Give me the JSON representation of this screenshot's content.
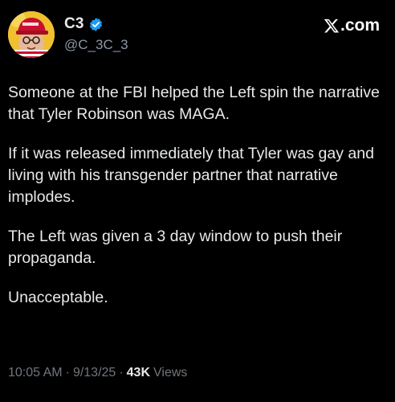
{
  "author": {
    "display_name": "C3",
    "handle": "@C_3C_3",
    "verified": true,
    "verified_color": "#1d9bf0",
    "avatar_icon": "avatar-red-cap-icon"
  },
  "brand": {
    "logo_icon": "x-logo-icon",
    "suffix": ".com"
  },
  "body": {
    "paragraphs": [
      "Someone at the FBI helped the Left spin the narrative that Tyler Robinson was MAGA.",
      "If it was released immediately that Tyler was gay and living with his transgender partner that narrative implodes.",
      "The Left was given a 3 day window to push their propaganda.",
      "Unacceptable."
    ]
  },
  "meta": {
    "time": "10:05 AM",
    "separator": "·",
    "date": "9/13/25",
    "views_count": "43K",
    "views_label": "Views"
  },
  "colors": {
    "background": "#000000",
    "text": "#e7e9ea",
    "secondary": "#71767b"
  }
}
